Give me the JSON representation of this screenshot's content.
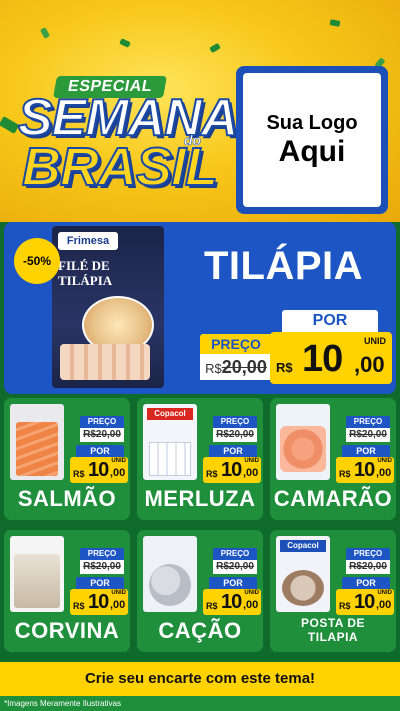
{
  "header": {
    "badge": "ESPECIAL",
    "title_line1": "SEMANA",
    "title_connector": "do",
    "title_line2": "BRASIL",
    "logo_line1": "Sua Logo",
    "logo_line2": "Aqui"
  },
  "featured": {
    "discount": "-50%",
    "product_brand": "Frimesa",
    "product_label": "FILÉ DE TILÁPIA",
    "title": "TILÁPIA",
    "preco_label": "PREÇO",
    "old_prefix": "R$",
    "old_price": "20,00",
    "por_label": "POR",
    "new_currency": "R$",
    "new_integer": "10",
    "new_cents": ",00",
    "unit": "UNID"
  },
  "cards": [
    {
      "name": "SALMÃO",
      "preco_label": "PREÇO",
      "old_price": "R$20,00",
      "por_label": "POR",
      "currency": "R$",
      "integer": "10",
      "cents": ",00",
      "unit": "UNID"
    },
    {
      "name": "MERLUZA",
      "brand": "Copacol",
      "preco_label": "PREÇO",
      "old_price": "R$20,00",
      "por_label": "POR",
      "currency": "R$",
      "integer": "10",
      "cents": ",00",
      "unit": "UNID"
    },
    {
      "name": "CAMARÃO",
      "preco_label": "PREÇO",
      "old_price": "R$20,00",
      "por_label": "POR",
      "currency": "R$",
      "integer": "10",
      "cents": ",00",
      "unit": "UNID"
    },
    {
      "name": "CORVINA",
      "preco_label": "PREÇO",
      "old_price": "R$20,00",
      "por_label": "POR",
      "currency": "R$",
      "integer": "10",
      "cents": ",00",
      "unit": "UNID"
    },
    {
      "name": "CAÇÃO",
      "preco_label": "PREÇO",
      "old_price": "R$20,00",
      "por_label": "POR",
      "currency": "R$",
      "integer": "10",
      "cents": ",00",
      "unit": "UNID"
    },
    {
      "name": "POSTA DE TILAPIA",
      "brand": "Copacol",
      "preco_label": "PREÇO",
      "old_price": "R$20,00",
      "por_label": "POR",
      "currency": "R$",
      "integer": "10",
      "cents": ",00",
      "unit": "UNID"
    }
  ],
  "cta": "Crie seu encarte com este tema!",
  "disclaimer": "*Imagens Meramente Ilustrativas",
  "colors": {
    "yellow": "#ffd200",
    "blue": "#1e55c4",
    "green_dark": "#0e6b2b",
    "green_card": "#1f8f3b"
  }
}
